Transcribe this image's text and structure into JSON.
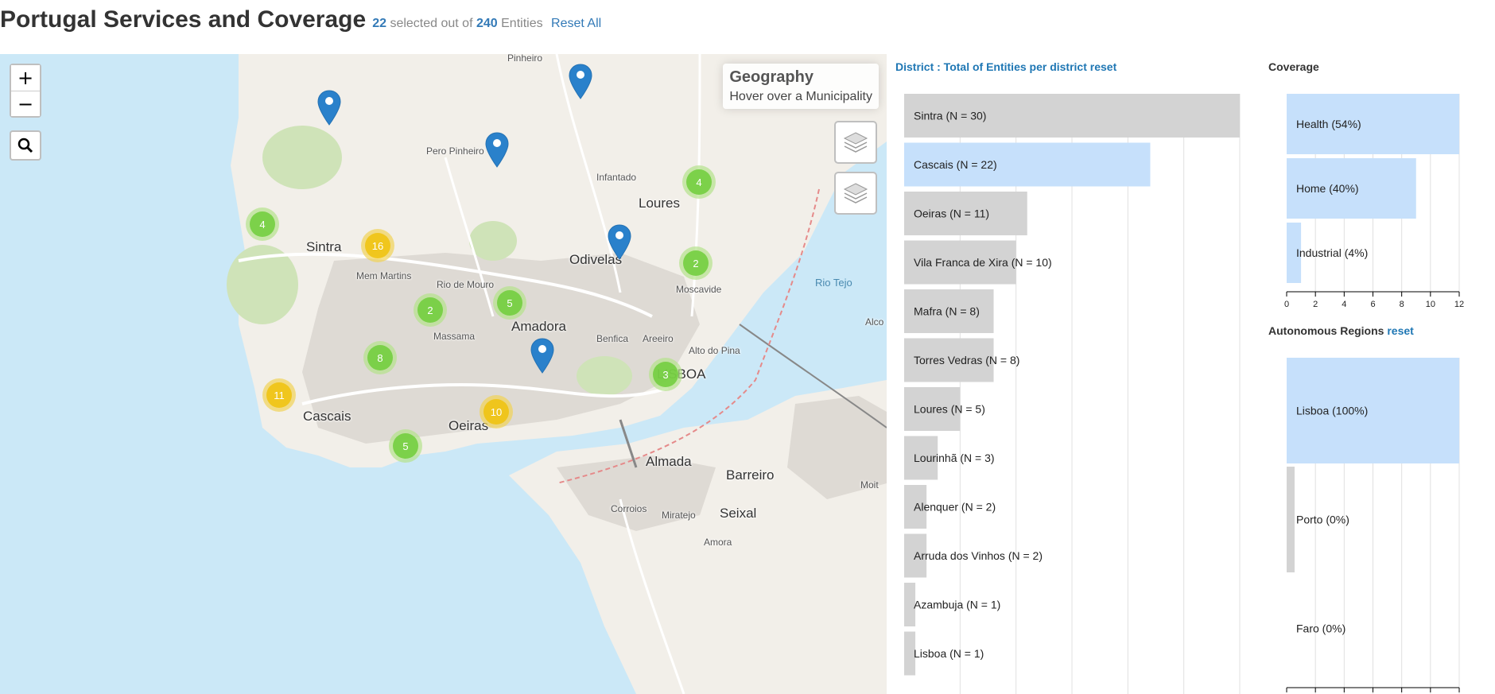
{
  "header": {
    "title": "Portugal Services and Coverage",
    "selected": "22",
    "selected_text": "selected out of",
    "total": "240",
    "entities_text": "Entities",
    "reset_all": "Reset All"
  },
  "map": {
    "info_title": "Geography",
    "info_hint": "Hover over a Municipality",
    "clusters": [
      "4",
      "16",
      "2",
      "5",
      "4",
      "2",
      "8",
      "11",
      "10",
      "5",
      "3"
    ],
    "places": {
      "sintra": "Sintra",
      "loures": "Loures",
      "odivelas": "Odivelas",
      "amadora": "Amadora",
      "lisboa": "LISBOA",
      "cascais": "Cascais",
      "oeiras": "Oeiras",
      "almada": "Almada",
      "barreiro": "Barreiro",
      "seixal": "Seixal",
      "mem_martins": "Mem Martins",
      "rio_de_mouro": "Rio de Mouro",
      "massama": "Massama",
      "pero_pinheiro": "Pero Pinheiro",
      "infantado": "Infantado",
      "moscavide": "Moscavide",
      "benfica": "Benfica",
      "areeiro": "Areeiro",
      "alto_do_pina": "Alto do Pina",
      "rio_tejo": "Rio Tejo",
      "pinheiro": "Pinheiro",
      "amora": "Amora",
      "corroios": "Corroios",
      "miratejo": "Miratejo",
      "moita": "Moit",
      "alcochete": "Alco"
    }
  },
  "district_chart": {
    "title": "District : Total of Entities per district",
    "reset": "reset"
  },
  "coverage_chart": {
    "title": "Coverage"
  },
  "regions_chart": {
    "title": "Autonomous Regions",
    "reset": "reset"
  },
  "colors": {
    "selected_bar": "#c6e0fb",
    "unselected_bar": "#d3d3d3",
    "link": "#337ab7",
    "water": "#cbe8f7",
    "land": "#f2efe9"
  },
  "chart_data": [
    {
      "type": "bar",
      "orientation": "horizontal",
      "categories": [
        "Sintra (N = 30)",
        "Cascais (N = 22)",
        "Oeiras (N = 11)",
        "Vila Franca de Xira (N = 10)",
        "Mafra (N = 8)",
        "Torres Vedras (N = 8)",
        "Loures (N = 5)",
        "Lourinhã (N = 3)",
        "Alenquer (N = 2)",
        "Arruda dos Vinhos (N = 2)",
        "Azambuja (N = 1)",
        "Lisboa (N = 1)"
      ],
      "values": [
        30,
        22,
        11,
        10,
        8,
        8,
        5,
        3,
        2,
        2,
        1,
        1
      ],
      "selected": [
        false,
        true,
        false,
        false,
        false,
        false,
        false,
        false,
        false,
        false,
        false,
        false
      ],
      "xlim": [
        0,
        30
      ],
      "grid": true
    },
    {
      "type": "bar",
      "orientation": "horizontal",
      "categories": [
        "Health (54%)",
        "Home (40%)",
        "Industrial (4%)"
      ],
      "values": [
        12,
        9,
        1
      ],
      "selected": [
        true,
        true,
        true
      ],
      "xlim": [
        0,
        12
      ],
      "xticks": [
        "0",
        "2",
        "4",
        "6",
        "8",
        "10",
        "12"
      ],
      "grid": true
    },
    {
      "type": "bar",
      "orientation": "horizontal",
      "categories": [
        "Lisboa (100%)",
        "Porto (0%)",
        "Faro (0%)"
      ],
      "values": [
        22,
        0,
        0
      ],
      "selected": [
        true,
        false,
        false
      ],
      "xlim": [
        0,
        22
      ],
      "grid": true
    }
  ]
}
